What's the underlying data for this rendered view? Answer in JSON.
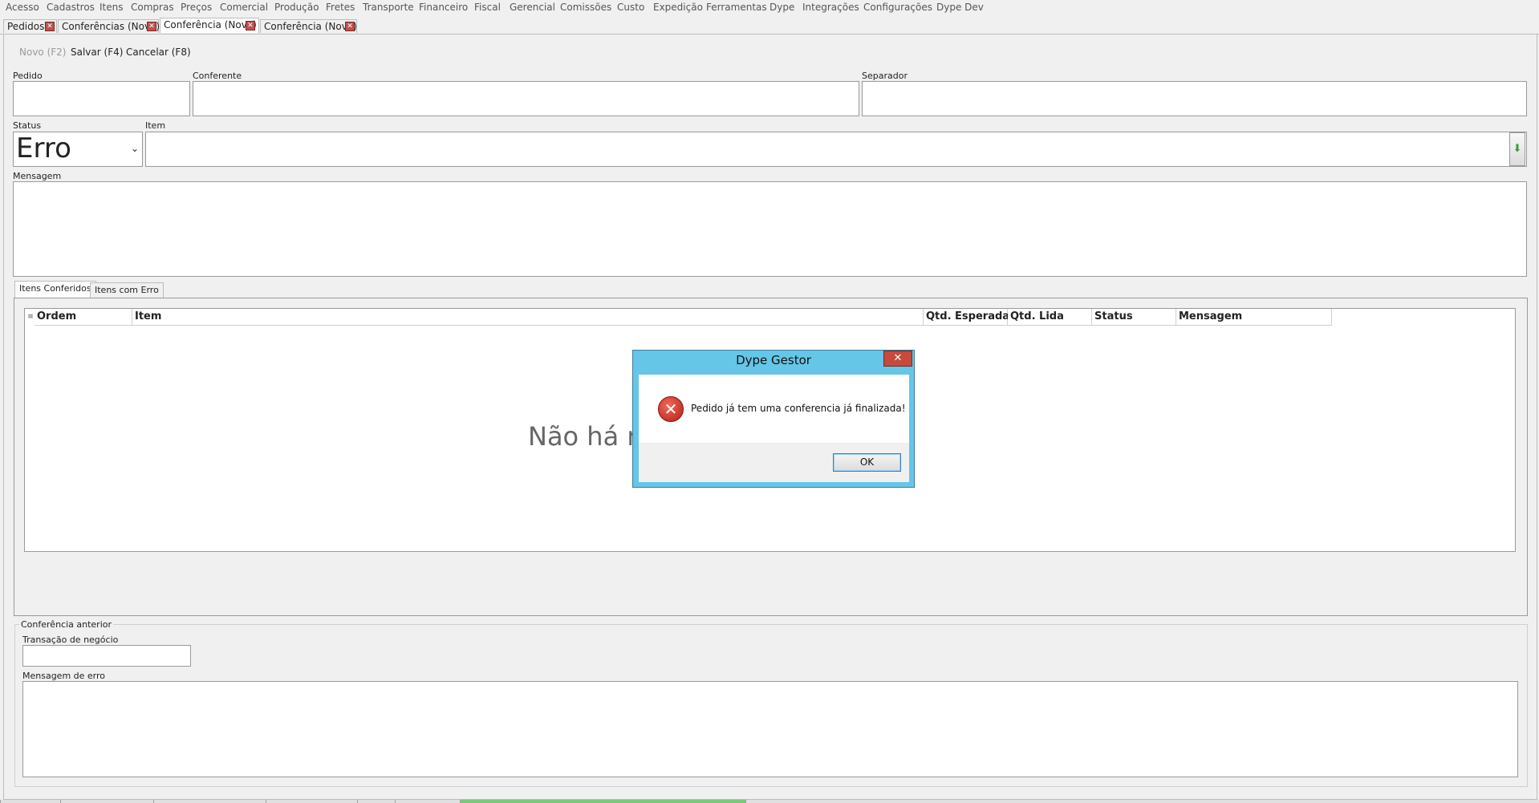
{
  "menu": [
    "Acesso",
    "Cadastros",
    "Itens",
    "Compras",
    "Preços",
    "Comercial",
    "Produção",
    "Fretes",
    "Transporte",
    "Financeiro",
    "Fiscal",
    "Gerencial",
    "Comissões",
    "Custo",
    "Expedição",
    "Ferramentas",
    "Dype",
    "Integrações",
    "Configurações",
    "Dype Dev"
  ],
  "doc_tabs": [
    "Pedidos",
    "Conferências (Novo)",
    "Conferência (Novo)",
    "Conferência (Novo)"
  ],
  "toolbar": {
    "novo": "Novo (F2)",
    "salvar": "Salvar (F4)",
    "cancelar": "Cancelar (F8)"
  },
  "form": {
    "pedido_label": "Pedido",
    "conferente_label": "Conferente",
    "separador_label": "Separador",
    "status_label": "Status",
    "status_value": "Erro",
    "item_label": "Item",
    "mensagem_label": "Mensagem"
  },
  "tabs": [
    "Itens Conferidos",
    "Itens com Erro"
  ],
  "grid": {
    "columns": [
      "Ordem",
      "Item",
      "Qtd. Esperada",
      "Qtd. Lida",
      "Status",
      "Mensagem"
    ],
    "empty_text": "Não há re"
  },
  "previous": {
    "group_label": "Conferência anterior",
    "transacao_label": "Transação de negócio",
    "erro_label": "Mensagem de erro"
  },
  "dialog": {
    "title": "Dype Gestor",
    "close": "✕",
    "message": "Pedido já tem uma conferencia já finalizada!",
    "ok": "OK",
    "icon": "error-icon"
  }
}
